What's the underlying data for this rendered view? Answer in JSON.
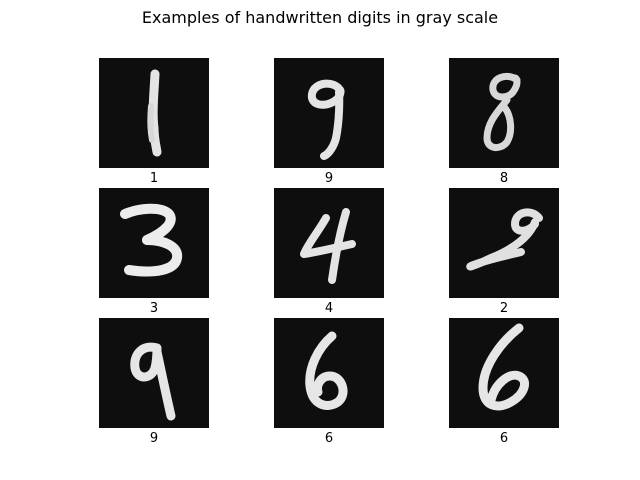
{
  "title": "Examples of handwritten digits in gray scale",
  "colors": {
    "background": "#ffffff",
    "image_background": "#0e0e0e",
    "stroke": "#e8e8e8"
  },
  "digits": [
    {
      "label": "1"
    },
    {
      "label": "9"
    },
    {
      "label": "8"
    },
    {
      "label": "3"
    },
    {
      "label": "4"
    },
    {
      "label": "2"
    },
    {
      "label": "9"
    },
    {
      "label": "6"
    },
    {
      "label": "6"
    }
  ]
}
